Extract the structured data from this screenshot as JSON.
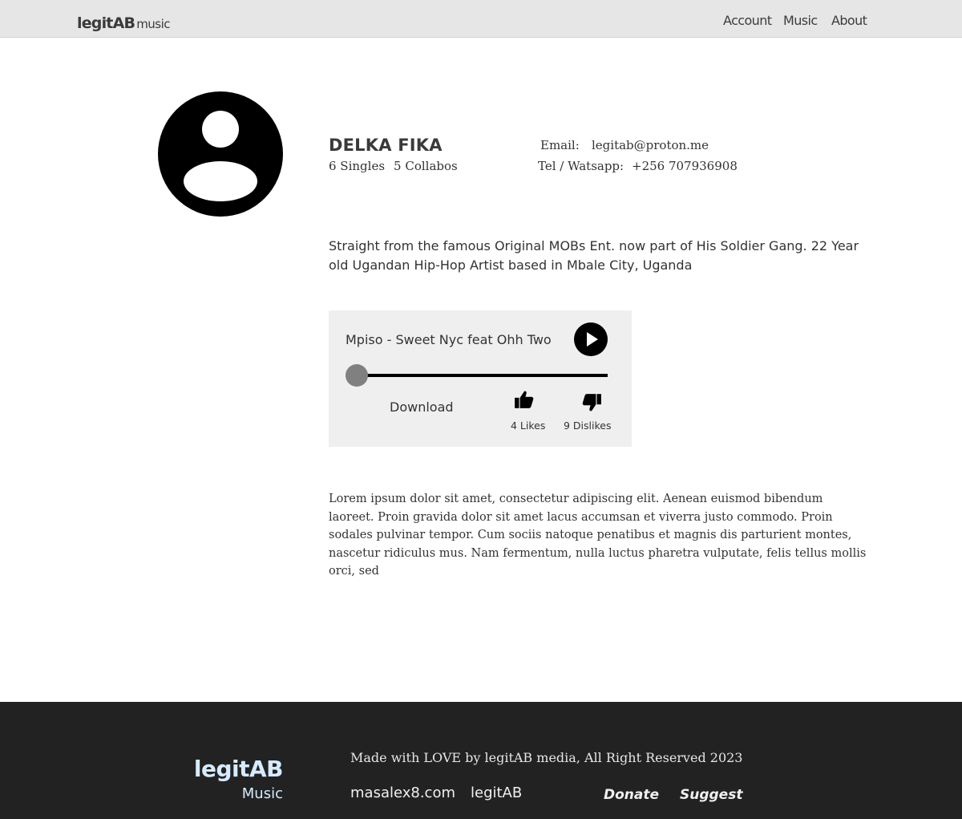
{
  "navbar": {
    "brand_main": "legitAB",
    "brand_sub": "music",
    "links": [
      "Account",
      "Music",
      "About"
    ]
  },
  "profile": {
    "avatar_icon": "user-circle-icon",
    "name": "DELKA FIKA",
    "singles": "6 Singles",
    "collabos": "5 Collabos",
    "email_label": "Email:",
    "email_value": "legitab@proton.me",
    "phone_label": "Tel / Watsapp:",
    "phone_value": "+256 707936908",
    "bio": "Straight from the famous Original MOBs Ent. now part of His Soldier Gang. 22 Year old Ugandan Hip-Hop Artist based in Mbale City, Uganda"
  },
  "player": {
    "track_title": "Mpiso - Sweet Nyc feat Ohh Two",
    "progress": 0,
    "download_label": "Download",
    "likes": "4 Likes",
    "dislikes": "9 Dislikes",
    "icons": {
      "play": "play-icon",
      "like": "thumbs-up-icon",
      "dislike": "thumbs-down-icon"
    }
  },
  "description": "Lorem ipsum dolor sit amet, consectetur adipiscing elit. Aenean euismod bibendum laoreet. Proin gravida dolor sit amet lacus accumsan et viverra justo commodo. Proin sodales pulvinar tempor. Cum sociis natoque penatibus et magnis dis parturient montes, nascetur ridiculus mus. Nam fermentum, nulla luctus pharetra vulputate, felis tellus mollis orci, sed",
  "footer": {
    "logo_main": "legitAB",
    "logo_sub": "Music",
    "credit": "Made with LOVE by legitAB media,  All Right Reserved 2023",
    "links": [
      "masalex8.com",
      "legitAB"
    ],
    "actions": [
      "Donate",
      "Suggest"
    ]
  },
  "colors": {
    "navbar_bg": "#e6e6e6",
    "player_bg": "#efefef",
    "footer_bg": "#222222",
    "footer_logo": "#d6ebff",
    "progress_thumb": "#808080"
  }
}
